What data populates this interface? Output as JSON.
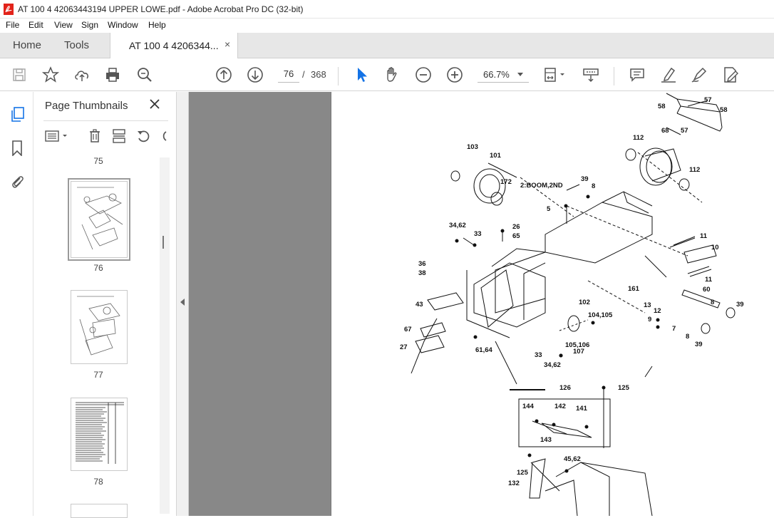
{
  "window": {
    "title": "AT 100 4 42063443194 UPPER LOWE.pdf - Adobe Acrobat Pro DC (32-bit)"
  },
  "menu": [
    "File",
    "Edit",
    "View",
    "Sign",
    "Window",
    "Help"
  ],
  "tabs": {
    "home": "Home",
    "tools": "Tools",
    "document": "AT 100 4 4206344...",
    "close": "×"
  },
  "toolbar": {
    "current_page": "76",
    "separator": "/",
    "total_pages": "368",
    "zoom": "66.7%"
  },
  "thumbnails": {
    "header": "Page Thumbnails",
    "pages": [
      "75",
      "76",
      "77",
      "78"
    ],
    "selected": "76"
  },
  "icons": {
    "save": "save-icon",
    "star": "star-icon",
    "upload": "upload-icon",
    "print": "print-icon",
    "zoom_search": "zoom-search-icon",
    "prev": "prev-page-icon",
    "next": "next-page-icon",
    "select": "cursor-arrow-icon",
    "hand": "hand-icon",
    "zoom_out": "zoom-out-icon",
    "zoom_in": "zoom-in-icon",
    "fit": "fit-page-icon",
    "scroll": "scroll-mode-icon",
    "comment": "comment-icon",
    "highlight": "highlight-icon",
    "draw": "draw-icon",
    "fill_sign": "fill-sign-icon"
  },
  "colors": {
    "accent": "#1473e6",
    "acrobat_red": "#e2231a",
    "doc_bg": "#888888"
  },
  "diagram": {
    "labels": [
      "57",
      "58",
      "58",
      "57",
      "68",
      "112",
      "112",
      "103",
      "101",
      "39",
      "8",
      "172",
      "2:BOOM,2ND",
      "5",
      "34,62",
      "26",
      "65",
      "33",
      "11",
      "10",
      "36",
      "38",
      "11",
      "161",
      "60",
      "8",
      "39",
      "43",
      "13",
      "12",
      "9",
      "102",
      "104,105",
      "7",
      "8",
      "39",
      "67",
      "27",
      "61,64",
      "33",
      "105,106",
      "107",
      "34,62",
      "126",
      "125",
      "144",
      "142",
      "141",
      "143",
      "45,62",
      "125",
      "132"
    ]
  }
}
